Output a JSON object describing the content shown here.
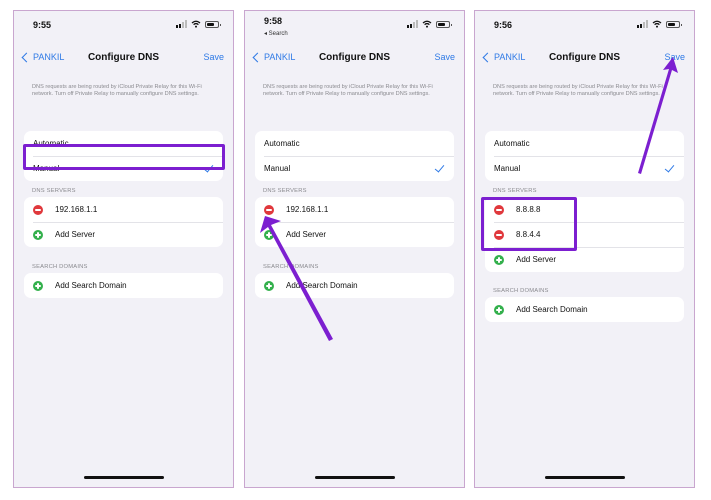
{
  "panels": [
    {
      "time": "9:55",
      "back_app": "",
      "nav": {
        "back": "PANKIL",
        "title": "Configure DNS",
        "save": "Save"
      },
      "note": "DNS requests are being routed by iCloud Private Relay for this Wi-Fi network. Turn off Private Relay to manually configure DNS settings.",
      "modes": [
        "Automatic",
        "Manual"
      ],
      "dns_label": "DNS SERVERS",
      "servers": [
        "192.168.1.1"
      ],
      "add_server": "Add Server",
      "search_label": "SEARCH DOMAINS",
      "add_search": "Add Search Domain"
    },
    {
      "time": "9:58",
      "back_app": "◂ Search",
      "nav": {
        "back": "PANKIL",
        "title": "Configure DNS",
        "save": "Save"
      },
      "note": "DNS requests are being routed by iCloud Private Relay for this Wi-Fi network. Turn off Private Relay to manually configure DNS settings.",
      "modes": [
        "Automatic",
        "Manual"
      ],
      "dns_label": "DNS SERVERS",
      "servers": [
        "192.168.1.1"
      ],
      "add_server": "Add Server",
      "search_label": "SEARCH DOMAINS",
      "add_search": "Add Search Domain"
    },
    {
      "time": "9:56",
      "back_app": "",
      "nav": {
        "back": "PANKIL",
        "title": "Configure DNS",
        "save": "Save"
      },
      "note": "DNS requests are being routed by iCloud Private Relay for this Wi-Fi network. Turn off Private Relay to manually configure DNS settings.",
      "modes": [
        "Automatic",
        "Manual"
      ],
      "dns_label": "DNS SERVERS",
      "servers": [
        "8.8.8.8",
        "8.8.4.4"
      ],
      "add_server": "Add Server",
      "search_label": "SEARCH DOMAINS",
      "add_search": "Add Search Domain"
    }
  ],
  "colors": {
    "accent": "#2f7ae6",
    "annotation": "#7c1fd0",
    "delete": "#e0383c",
    "add": "#33b04c"
  }
}
